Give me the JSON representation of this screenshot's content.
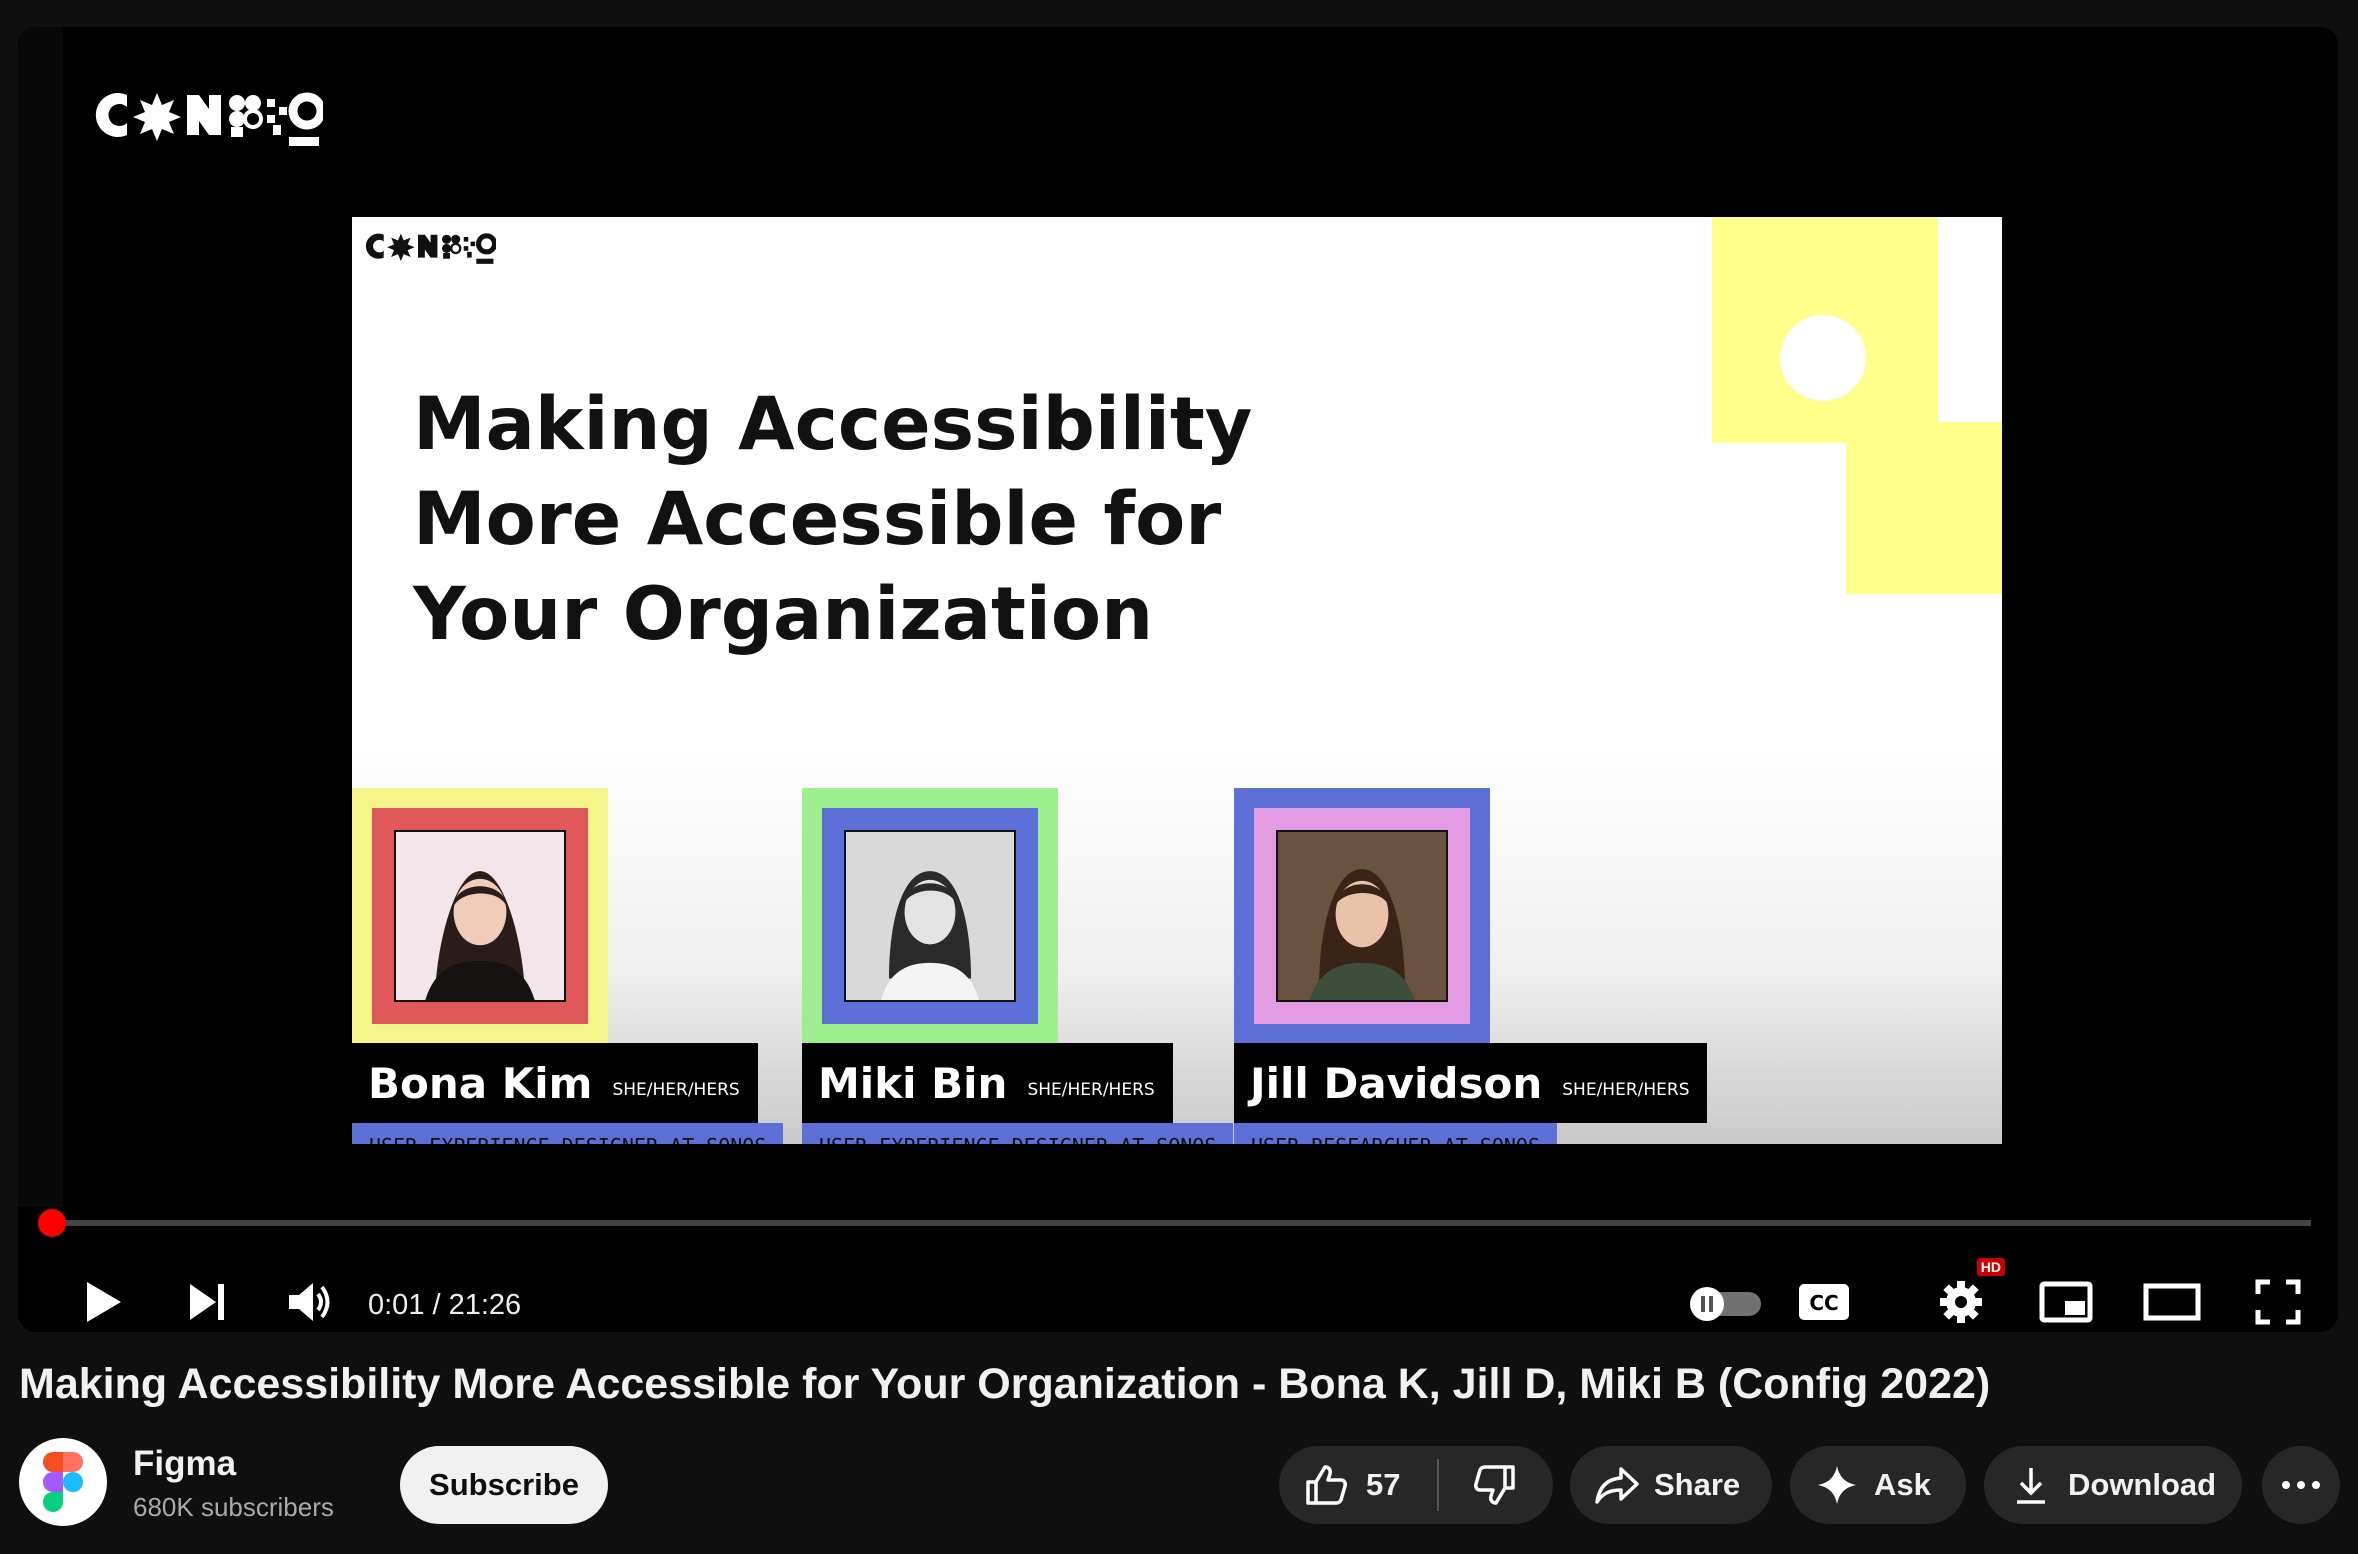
{
  "player": {
    "slide": {
      "title_lines": [
        "Making Accessibility",
        "More Accessible for",
        "Your Organization"
      ],
      "speakers": [
        {
          "name": "Bona Kim",
          "pronouns": "SHE/HER/HERS",
          "role": "USER EXPERIENCE DESIGNER AT SONOS",
          "outer_color": "#f6f58c",
          "inner_color": "#e0595a"
        },
        {
          "name": "Miki Bin",
          "pronouns": "SHE/HER/HERS",
          "role": "USER EXPERIENCE DESIGNER AT SONOS",
          "outer_color": "#9ef08e",
          "inner_color": "#5b6fd6"
        },
        {
          "name": "Jill Davidson",
          "pronouns": "SHE/HER/HERS",
          "role": "USER RESEARCHER AT SONOS",
          "outer_color": "#5b6fd6",
          "inner_color": "#e39be4"
        }
      ]
    },
    "controls": {
      "time": "0:01 / 21:26",
      "progress_fraction": 0.0008,
      "quality_badge": "HD",
      "icons": [
        "play-icon",
        "next-icon",
        "volume-icon",
        "autoplay-toggle",
        "cc-icon",
        "settings-icon",
        "miniplayer-icon",
        "theater-icon",
        "fullscreen-icon"
      ]
    }
  },
  "video": {
    "title": "Making Accessibility More Accessible for Your Organization - Bona K, Jill D, Miki B (Config 2022)"
  },
  "channel": {
    "name": "Figma",
    "subscribers": "680K subscribers",
    "subscribe_label": "Subscribe"
  },
  "actions": {
    "likes": "57",
    "share_label": "Share",
    "ask_label": "Ask",
    "download_label": "Download"
  },
  "colors": {
    "accent": "#ff0000",
    "background": "#0f0f0f",
    "pill": "#272727"
  }
}
